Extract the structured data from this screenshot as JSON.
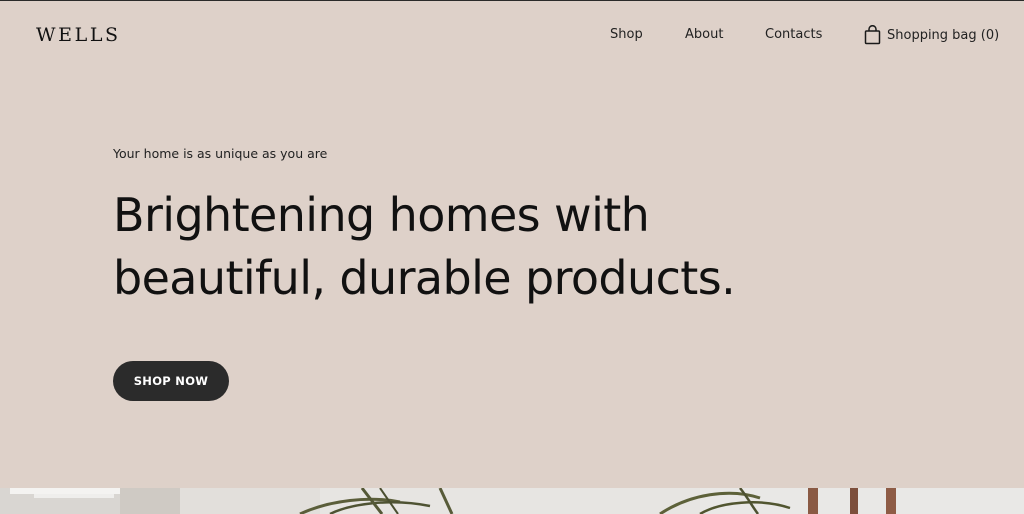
{
  "header": {
    "logo": "WELLS",
    "nav": {
      "shop": "Shop",
      "about": "About",
      "contacts": "Contacts"
    },
    "bag": {
      "label": "Shopping bag (0)",
      "icon": "shopping-bag-icon"
    }
  },
  "hero": {
    "eyebrow": "Your home is as unique as you are",
    "headline_line_1": "Brightening homes with",
    "headline_line_2": "beautiful, durable products.",
    "cta_label": "SHOP NOW"
  },
  "colors": {
    "background": "#ded1c9",
    "button": "#2b2b2b",
    "text": "#111111"
  }
}
